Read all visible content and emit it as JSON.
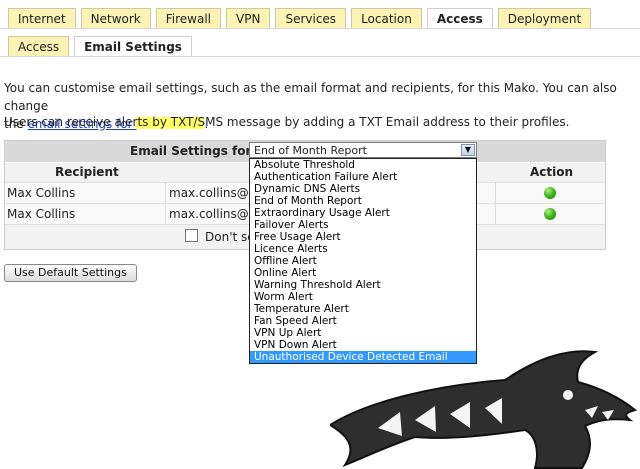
{
  "tabs_main": [
    {
      "label": "Internet",
      "active": false
    },
    {
      "label": "Network",
      "active": false
    },
    {
      "label": "Firewall",
      "active": false
    },
    {
      "label": "VPN",
      "active": false
    },
    {
      "label": "Services",
      "active": false
    },
    {
      "label": "Location",
      "active": false
    },
    {
      "label": "Access",
      "active": true
    },
    {
      "label": "Deployment",
      "active": false
    }
  ],
  "tabs_sub": [
    {
      "label": "Access",
      "active": false
    },
    {
      "label": "Email Settings",
      "active": true
    }
  ],
  "intro": {
    "line1": "You can customise email settings, such as the email format and recipients, for this Mako. You can also change",
    "line2_prefix": "the",
    "link": "email settings for",
    "line2_suffix": ".",
    "line3": "Users can receive alerts by TXT/SMS message by adding a TXT Email address to their profiles."
  },
  "settings": {
    "header_label": "Email Settings for",
    "col_recipient": "Recipient",
    "col_action": "Action",
    "rows": [
      {
        "recipient": "Max Collins",
        "email": "max.collins@ir"
      },
      {
        "recipient": "Max Collins",
        "email": "max.collins@ir"
      }
    ],
    "checkbox_label": "Don't se"
  },
  "select": {
    "value": "End of Month Report",
    "options": [
      "Absolute Threshold",
      "Authentication Failure Alert",
      "Dynamic DNS Alerts",
      "End of Month Report",
      "Extraordinary Usage Alert",
      "Failover Alerts",
      "Free Usage Alert",
      "Licence Alerts",
      "Offline Alert",
      "Online Alert",
      "Warning Threshold Alert",
      "Worm Alert",
      "Temperature Alert",
      "Fan Speed Alert",
      "VPN Up Alert",
      "VPN Down Alert",
      "Unauthorised Device Detected Email"
    ],
    "highlighted_option": "Unauthorised Device Detected Email"
  },
  "buttons": {
    "default_settings": "Use Default Settings"
  },
  "colors": {
    "tab_bg": "#fbf3b4",
    "highlight": "#3399ff",
    "link": "#1a3fbf"
  }
}
